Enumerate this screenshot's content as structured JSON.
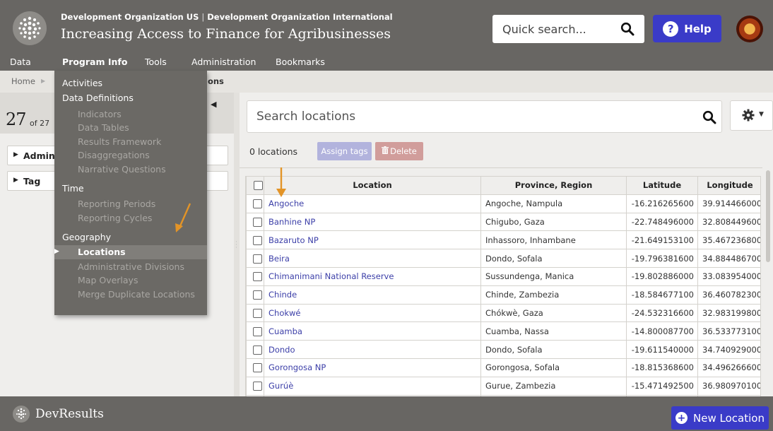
{
  "header": {
    "org_primary": "Development Organization US",
    "org_separator": "|",
    "org_secondary": "Development Organization International",
    "program_title": "Increasing Access to Finance for Agribusinesses",
    "quick_search_placeholder": "Quick search...",
    "help_label": "Help"
  },
  "nav": {
    "items": [
      "Data",
      "Program Info",
      "Tools",
      "Administration",
      "Bookmarks"
    ],
    "active": "Program Info"
  },
  "breadcrumb": {
    "home": "Home",
    "current_fragment": "ions"
  },
  "left_panel": {
    "count_big": "27",
    "count_small": "of 27",
    "facets": [
      "Admin",
      "Tag"
    ]
  },
  "program_menu": {
    "sections": [
      {
        "title": "Activities",
        "items": []
      },
      {
        "title": "Data Definitions",
        "items": [
          "Indicators",
          "Data Tables",
          "Results Framework",
          "Disaggregations",
          "Narrative Questions"
        ]
      },
      {
        "title": "Time",
        "items": [
          "Reporting Periods",
          "Reporting Cycles"
        ]
      },
      {
        "title": "Geography",
        "items": [
          "Locations",
          "Administrative Divisions",
          "Map Overlays",
          "Merge Duplicate Locations"
        ]
      }
    ],
    "active_item": "Locations"
  },
  "locations": {
    "search_placeholder": "Search locations",
    "selected_count_label": "0 locations",
    "assign_tags_label": "Assign tags",
    "delete_label": "Delete",
    "columns": [
      "Location",
      "Province, Region",
      "Latitude",
      "Longitude"
    ],
    "rows": [
      [
        "Angoche",
        "Angoche, Nampula",
        "-16.216265600",
        "39.914466000"
      ],
      [
        "Banhine NP",
        "Chigubo, Gaza",
        "-22.748496000",
        "32.808449600"
      ],
      [
        "Bazaruto NP",
        "Inhassoro, Inhambane",
        "-21.649153100",
        "35.467236800"
      ],
      [
        "Beira",
        "Dondo, Sofala",
        "-19.796381600",
        "34.884486700"
      ],
      [
        "Chimanimani National Reserve",
        "Sussundenga, Manica",
        "-19.802886000",
        "33.083954000"
      ],
      [
        "Chinde",
        "Chinde, Zambezia",
        "-18.584677100",
        "36.460782300"
      ],
      [
        "Chokwé",
        "Chókwè, Gaza",
        "-24.532316600",
        "32.983199800"
      ],
      [
        "Cuamba",
        "Cuamba, Nassa",
        "-14.800087700",
        "36.533773100"
      ],
      [
        "Dondo",
        "Dondo, Sofala",
        "-19.611540000",
        "34.740929000"
      ],
      [
        "Gorongosa NP",
        "Gorongosa, Sofala",
        "-18.815368600",
        "34.496266600"
      ],
      [
        "Gurúè",
        "Gurue, Zambezia",
        "-15.471492500",
        "36.980970100"
      ],
      [
        "",
        "",
        "",
        ""
      ]
    ]
  },
  "footer": {
    "brand": "DevResults",
    "new_location_label": "New Location"
  },
  "colors": {
    "header_bg": "#686663",
    "accent_blue": "#3a3bc8",
    "link_blue": "#3c3fa8",
    "annotation_arrow": "#e39427"
  }
}
